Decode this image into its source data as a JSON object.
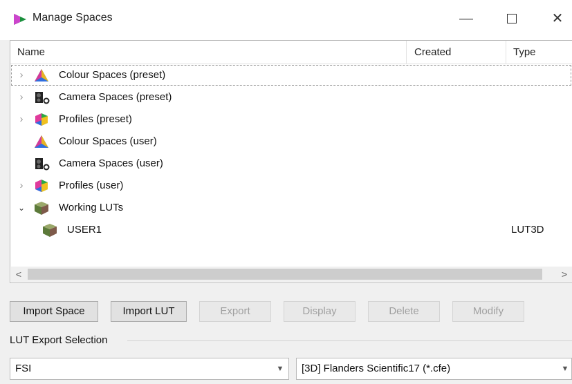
{
  "window": {
    "title": "Manage Spaces"
  },
  "tree": {
    "columns": {
      "name": "Name",
      "created": "Created",
      "type": "Type"
    },
    "rows": [
      {
        "label": "Colour Spaces (preset)",
        "expander": "›",
        "created": "",
        "type": "",
        "icon": "colour-spaces-icon"
      },
      {
        "label": "Camera Spaces (preset)",
        "expander": "›",
        "created": "",
        "type": "",
        "icon": "camera-icon"
      },
      {
        "label": "Profiles (preset)",
        "expander": "›",
        "created": "",
        "type": "",
        "icon": "profiles-icon"
      },
      {
        "label": "Colour Spaces (user)",
        "expander": "",
        "created": "",
        "type": "",
        "icon": "colour-spaces-icon"
      },
      {
        "label": "Camera Spaces (user)",
        "expander": "",
        "created": "",
        "type": "",
        "icon": "camera-icon"
      },
      {
        "label": "Profiles (user)",
        "expander": "›",
        "created": "",
        "type": "",
        "icon": "profiles-icon"
      },
      {
        "label": "Working LUTs",
        "expander": "⌄",
        "created": "",
        "type": "",
        "icon": "lut-cube-icon"
      },
      {
        "label": "USER1",
        "expander": "",
        "created": "",
        "type": "LUT3D",
        "icon": "lut-cube-icon"
      }
    ]
  },
  "scrollbar": {
    "left_arrow": "<",
    "right_arrow": ">"
  },
  "buttons": {
    "import_space": "Import Space",
    "import_lut": "Import LUT",
    "export": "Export",
    "display": "Display",
    "delete": "Delete",
    "modify": "Modify"
  },
  "lut_export": {
    "group_label": "LUT Export Selection",
    "device_value": "FSI",
    "format_value": "[3D] Flanders Scientific17 (*.cfe)"
  }
}
